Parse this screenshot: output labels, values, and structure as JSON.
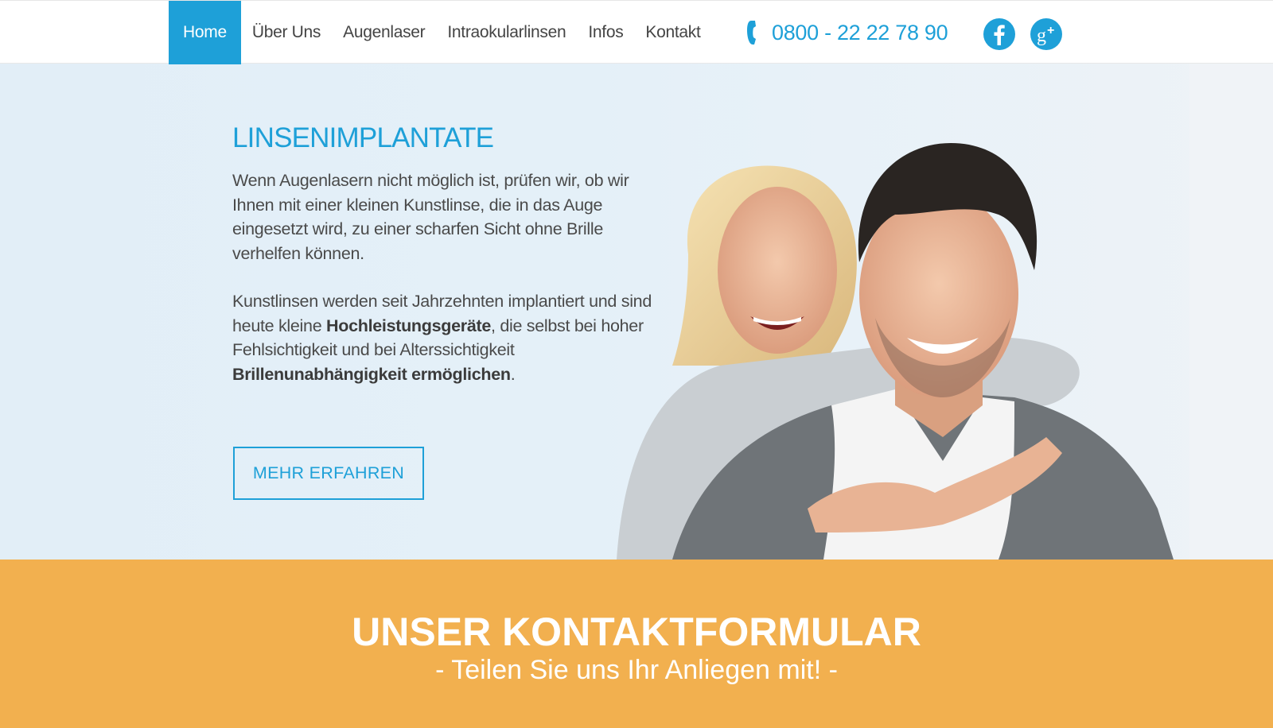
{
  "nav": {
    "items": [
      {
        "label": "Home",
        "active": true
      },
      {
        "label": "Über Uns",
        "active": false
      },
      {
        "label": "Augenlaser",
        "active": false
      },
      {
        "label": "Intraokularlinsen",
        "active": false
      },
      {
        "label": "Infos",
        "active": false
      },
      {
        "label": "Kontakt",
        "active": false
      }
    ],
    "phone": "0800 - 22 22 78 90",
    "phone_icon": "phone-icon",
    "social": [
      {
        "icon": "facebook-icon"
      },
      {
        "icon": "google-plus-icon"
      }
    ]
  },
  "hero": {
    "title": "LINSENIMPLANTATE",
    "paragraph1": "Wenn Augenlasern nicht möglich ist, prüfen wir, ob wir Ihnen mit einer kleinen Kunstlinse, die in das Auge eingesetzt wird, zu einer scharfen Sicht ohne Brille verhelfen können.",
    "paragraph2": {
      "part1": "Kunstlinsen werden seit Jahrzehnten implantiert und sind heute kleine ",
      "bold1": "Hochleistungsgeräte",
      "part2": ", die selbst bei hoher Fehlsichtigkeit und bei Alterssichtigkeit ",
      "bold2": "Brillenunabhängigkeit ermöglichen",
      "part3": "."
    },
    "button": "MEHR ERFAHREN"
  },
  "contact": {
    "title": "UNSER KONTAKTFORMULAR",
    "subtitle": "- Teilen Sie uns Ihr Anliegen mit! -"
  },
  "colors": {
    "accent": "#1ea0d8",
    "band": "#f2b04f",
    "hero_bg": "#e2eef7"
  }
}
